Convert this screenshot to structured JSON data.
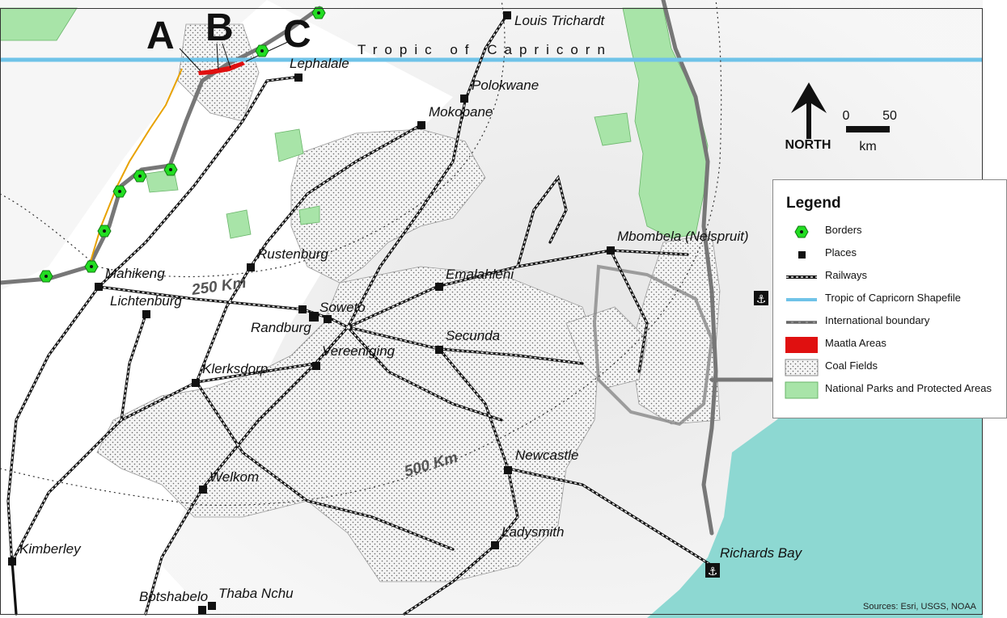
{
  "map": {
    "tropic_label": "Tropic of Capricorn",
    "site_letters": [
      "A",
      "B",
      "C"
    ],
    "distance_labels": [
      "250 Km",
      "500 Km"
    ],
    "places": [
      "Louis Trichardt",
      "Lephalale",
      "Polokwane",
      "Mokopane",
      "Rustenburg",
      "Mahikeng",
      "Lichtenburg",
      "Soweto",
      "Randburg",
      "Vereeniging",
      "Emalahleni",
      "Secunda",
      "Mbombela (Nelspruit)",
      "Klerksdorp",
      "Welkom",
      "Newcastle",
      "Ladysmith",
      "Kimberley",
      "Richards Bay",
      "Botshabelo",
      "Thaba Nchu"
    ],
    "colors": {
      "border_marker": "#22dd22",
      "tropic": "#6fc3e8",
      "maatla": "#e01010",
      "park": "#a8e4a8",
      "sea": "#8dd8d2",
      "coal_dot": "#555555"
    }
  },
  "north_arrow": {
    "label": "NORTH",
    "icon": "north-arrow-icon"
  },
  "scale_bar": {
    "start": "0",
    "end": "50",
    "unit": "km"
  },
  "legend": {
    "title": "Legend",
    "items": [
      {
        "label": "Borders",
        "icon": "border-post-icon"
      },
      {
        "label": "Places",
        "icon": "place-square-icon"
      },
      {
        "label": "Railways",
        "icon": "railway-line-icon"
      },
      {
        "label": "Tropic of Capricorn Shapefile",
        "icon": "tropic-line-icon"
      },
      {
        "label": "International boundary",
        "icon": "boundary-line-icon"
      },
      {
        "label": "Maatla Areas",
        "icon": "maatla-area-icon"
      },
      {
        "label": "Coal Fields",
        "icon": "coal-field-icon"
      },
      {
        "label": "National Parks and Protected Areas",
        "icon": "park-area-icon"
      }
    ]
  },
  "credits": "Sources: Esri, USGS, NOAA"
}
